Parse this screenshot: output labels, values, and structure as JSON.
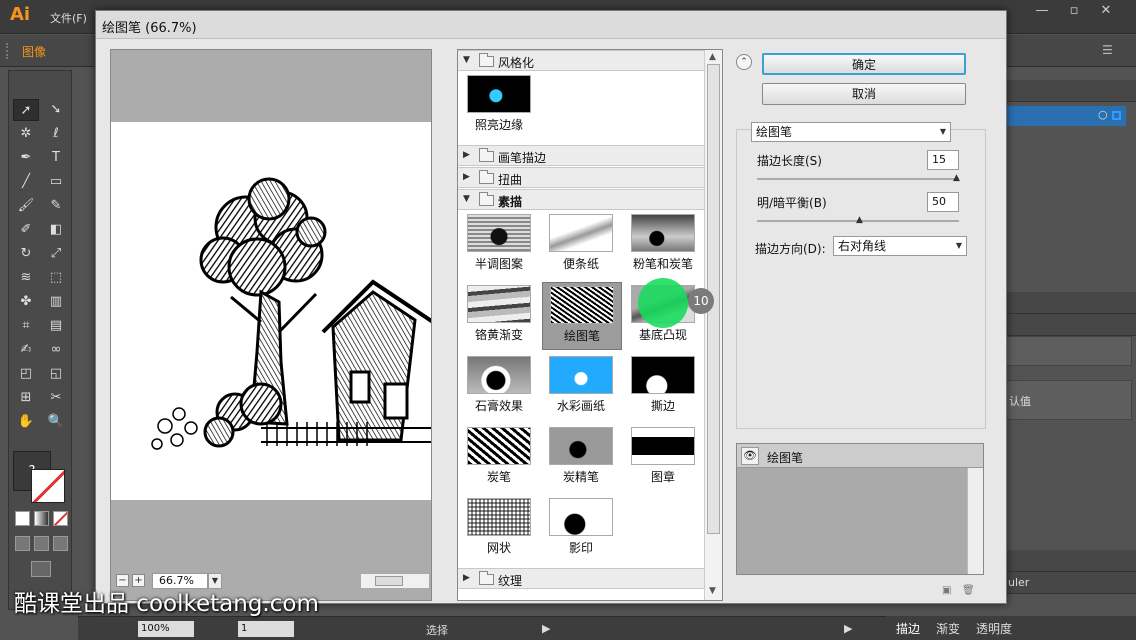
{
  "app": {
    "logo": "Ai",
    "menu_file": "文件(F)",
    "control_label": "图像"
  },
  "dialog": {
    "title": "绘图笔 (66.7%)",
    "zoom": {
      "minus": "−",
      "plus": "+",
      "value": "66.7%"
    },
    "gallery": {
      "groups": [
        {
          "name": "风格化",
          "expanded": true,
          "items": [
            "照亮边缘"
          ]
        },
        {
          "name": "画笔描边",
          "expanded": false
        },
        {
          "name": "扭曲",
          "expanded": false
        },
        {
          "name": "素描",
          "expanded": true,
          "items": [
            "半调图案",
            "便条纸",
            "粉笔和炭笔",
            "铬黄渐变",
            "绘图笔",
            "基底凸现",
            "石膏效果",
            "水彩画纸",
            "撕边",
            "炭笔",
            "炭精笔",
            "图章",
            "网状",
            "影印"
          ],
          "selected": "绘图笔"
        },
        {
          "name": "纹理",
          "expanded": false
        }
      ]
    },
    "buttons": {
      "ok": "确定",
      "cancel": "取消"
    },
    "filter_select": "绘图笔",
    "params": [
      {
        "label": "描边长度(S)",
        "value": "15",
        "slider": 0.99
      },
      {
        "label": "明/暗平衡(B)",
        "value": "50",
        "slider": 0.5
      }
    ],
    "direction": {
      "label": "描边方向(D):",
      "value": "右对角线"
    },
    "layer": {
      "name": "绘图笔",
      "eye": "👁"
    }
  },
  "overlay": {
    "click_badge": "10"
  },
  "right_panel": {
    "text_value": "认值",
    "ruler": "uler"
  },
  "status": {
    "zoom": "100%",
    "page": "1",
    "tool": "选择"
  },
  "bottom_tabs": [
    "描边",
    "渐变",
    "透明度"
  ],
  "tools": [
    "selection-tool",
    "direct-selection-tool",
    "magic-wand-tool",
    "lasso-tool",
    "pen-tool",
    "type-tool",
    "line-tool",
    "rectangle-tool",
    "paintbrush-tool",
    "pencil-tool",
    "blob-brush-tool",
    "eraser-tool",
    "rotate-tool",
    "scale-tool",
    "warp-tool",
    "free-transform-tool",
    "symbol-sprayer-tool",
    "column-graph-tool",
    "mesh-tool",
    "gradient-tool",
    "eyedropper-tool",
    "blend-tool",
    "live-paint-tool",
    "live-paint-selection-tool",
    "artboard-tool",
    "slice-tool",
    "hand-tool",
    "zoom-tool"
  ],
  "watermark": "酷课堂出品 coolketang.com",
  "colors": {
    "accent": "#f7941d",
    "focus": "#3ba0d8",
    "cursor": "#14dc5a"
  }
}
